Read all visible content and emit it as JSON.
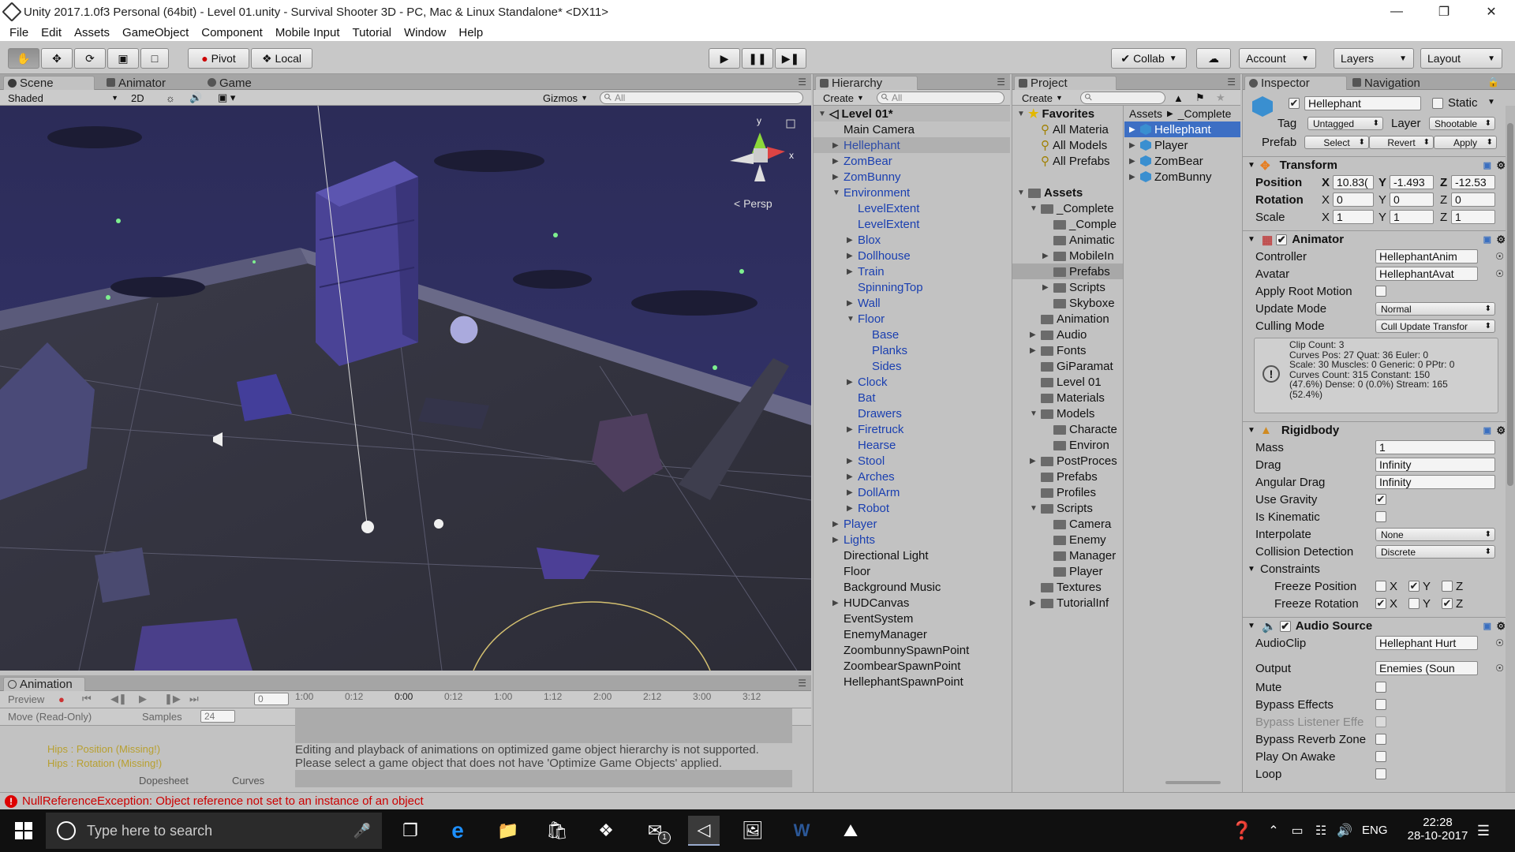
{
  "window": {
    "title": "Unity 2017.1.0f3 Personal (64bit) - Level 01.unity - Survival Shooter 3D - PC, Mac & Linux Standalone* <DX11>",
    "minimize": "—",
    "restore": "❐",
    "close": "✕"
  },
  "menu": [
    "File",
    "Edit",
    "Assets",
    "GameObject",
    "Component",
    "Mobile Input",
    "Tutorial",
    "Window",
    "Help"
  ],
  "toolbar": {
    "pivot": "Pivot",
    "local": "Local",
    "collab": "Collab",
    "account": "Account",
    "layers": "Layers",
    "layout": "Layout"
  },
  "scene": {
    "tabs": [
      "Scene",
      "Animator",
      "Game"
    ],
    "shading": "Shaded",
    "mode2d": "2D",
    "gizmos": "Gizmos",
    "search_placeholder": "All",
    "persp": "Persp",
    "axis_x": "x",
    "axis_y": "y"
  },
  "animation": {
    "tab": "Animation",
    "preview": "Preview",
    "frame": "0",
    "ruler": [
      "1:00",
      "0:12",
      "0:00",
      "0:12",
      "1:00",
      "1:12",
      "2:00",
      "2:12",
      "3:00",
      "3:12"
    ],
    "clip": "Move (Read-Only)",
    "samples_label": "Samples",
    "samples": "24",
    "props": [
      "Hips : Position (Missing!)",
      "Hips : Rotation (Missing!)"
    ],
    "message1": "Editing and playback of animations on optimized game object hierarchy is not supported.",
    "message2": "Please select a game object that does not have 'Optimize Game Objects' applied.",
    "dopesheet": "Dopesheet",
    "curves": "Curves"
  },
  "hierarchy": {
    "tab": "Hierarchy",
    "create": "Create",
    "search_placeholder": "All",
    "scene_name": "Level 01*",
    "items": [
      {
        "label": "Main Camera",
        "indent": 0,
        "arrow": "",
        "blue": false,
        "sel": false
      },
      {
        "label": "Hellephant",
        "indent": 0,
        "arrow": "▶",
        "blue": true,
        "sel": true
      },
      {
        "label": "ZomBear",
        "indent": 0,
        "arrow": "▶",
        "blue": true,
        "sel": false
      },
      {
        "label": "ZomBunny",
        "indent": 0,
        "arrow": "▶",
        "blue": true,
        "sel": false
      },
      {
        "label": "Environment",
        "indent": 0,
        "arrow": "▼",
        "blue": true,
        "sel": false
      },
      {
        "label": "LevelExtent",
        "indent": 1,
        "arrow": "",
        "blue": true,
        "sel": false
      },
      {
        "label": "LevelExtent",
        "indent": 1,
        "arrow": "",
        "blue": true,
        "sel": false
      },
      {
        "label": "Blox",
        "indent": 1,
        "arrow": "▶",
        "blue": true,
        "sel": false
      },
      {
        "label": "Dollhouse",
        "indent": 1,
        "arrow": "▶",
        "blue": true,
        "sel": false
      },
      {
        "label": "Train",
        "indent": 1,
        "arrow": "▶",
        "blue": true,
        "sel": false
      },
      {
        "label": "SpinningTop",
        "indent": 1,
        "arrow": "",
        "blue": true,
        "sel": false
      },
      {
        "label": "Wall",
        "indent": 1,
        "arrow": "▶",
        "blue": true,
        "sel": false
      },
      {
        "label": "Floor",
        "indent": 1,
        "arrow": "▼",
        "blue": true,
        "sel": false
      },
      {
        "label": "Base",
        "indent": 2,
        "arrow": "",
        "blue": true,
        "sel": false
      },
      {
        "label": "Planks",
        "indent": 2,
        "arrow": "",
        "blue": true,
        "sel": false
      },
      {
        "label": "Sides",
        "indent": 2,
        "arrow": "",
        "blue": true,
        "sel": false
      },
      {
        "label": "Clock",
        "indent": 1,
        "arrow": "▶",
        "blue": true,
        "sel": false
      },
      {
        "label": "Bat",
        "indent": 1,
        "arrow": "",
        "blue": true,
        "sel": false
      },
      {
        "label": "Drawers",
        "indent": 1,
        "arrow": "",
        "blue": true,
        "sel": false
      },
      {
        "label": "Firetruck",
        "indent": 1,
        "arrow": "▶",
        "blue": true,
        "sel": false
      },
      {
        "label": "Hearse",
        "indent": 1,
        "arrow": "",
        "blue": true,
        "sel": false
      },
      {
        "label": "Stool",
        "indent": 1,
        "arrow": "▶",
        "blue": true,
        "sel": false
      },
      {
        "label": "Arches",
        "indent": 1,
        "arrow": "▶",
        "blue": true,
        "sel": false
      },
      {
        "label": "DollArm",
        "indent": 1,
        "arrow": "▶",
        "blue": true,
        "sel": false
      },
      {
        "label": "Robot",
        "indent": 1,
        "arrow": "▶",
        "blue": true,
        "sel": false
      },
      {
        "label": "Player",
        "indent": 0,
        "arrow": "▶",
        "blue": true,
        "sel": false
      },
      {
        "label": "Lights",
        "indent": 0,
        "arrow": "▶",
        "blue": true,
        "sel": false
      },
      {
        "label": "Directional Light",
        "indent": 0,
        "arrow": "",
        "blue": false,
        "sel": false
      },
      {
        "label": "Floor",
        "indent": 0,
        "arrow": "",
        "blue": false,
        "sel": false
      },
      {
        "label": "Background Music",
        "indent": 0,
        "arrow": "",
        "blue": false,
        "sel": false
      },
      {
        "label": "HUDCanvas",
        "indent": 0,
        "arrow": "▶",
        "blue": false,
        "sel": false
      },
      {
        "label": "EventSystem",
        "indent": 0,
        "arrow": "",
        "blue": false,
        "sel": false
      },
      {
        "label": "EnemyManager",
        "indent": 0,
        "arrow": "",
        "blue": false,
        "sel": false
      },
      {
        "label": "ZoombunnySpawnPoint",
        "indent": 0,
        "arrow": "",
        "blue": false,
        "sel": false
      },
      {
        "label": "ZoombearSpawnPoint",
        "indent": 0,
        "arrow": "",
        "blue": false,
        "sel": false
      },
      {
        "label": "HellephantSpawnPoint",
        "indent": 0,
        "arrow": "",
        "blue": false,
        "sel": false
      }
    ]
  },
  "project": {
    "tab": "Project",
    "create": "Create",
    "favorites": "Favorites",
    "fav_items": [
      "All Materia",
      "All Models",
      "All Prefabs"
    ],
    "assets_root": "Assets",
    "folders": [
      {
        "label": "_Complete",
        "indent": 1,
        "arrow": "▼",
        "sel": false
      },
      {
        "label": "_Comple",
        "indent": 2,
        "arrow": "",
        "sel": false
      },
      {
        "label": "Animatic",
        "indent": 2,
        "arrow": "",
        "sel": false
      },
      {
        "label": "MobileIn",
        "indent": 2,
        "arrow": "▶",
        "sel": false
      },
      {
        "label": "Prefabs",
        "indent": 2,
        "arrow": "",
        "sel": true
      },
      {
        "label": "Scripts",
        "indent": 2,
        "arrow": "▶",
        "sel": false
      },
      {
        "label": "Skyboxe",
        "indent": 2,
        "arrow": "",
        "sel": false
      },
      {
        "label": "Animation",
        "indent": 1,
        "arrow": "",
        "sel": false
      },
      {
        "label": "Audio",
        "indent": 1,
        "arrow": "▶",
        "sel": false
      },
      {
        "label": "Fonts",
        "indent": 1,
        "arrow": "▶",
        "sel": false
      },
      {
        "label": "GiParamat",
        "indent": 1,
        "arrow": "",
        "sel": false
      },
      {
        "label": "Level 01",
        "indent": 1,
        "arrow": "",
        "sel": false
      },
      {
        "label": "Materials",
        "indent": 1,
        "arrow": "",
        "sel": false
      },
      {
        "label": "Models",
        "indent": 1,
        "arrow": "▼",
        "sel": false
      },
      {
        "label": "Characte",
        "indent": 2,
        "arrow": "",
        "sel": false
      },
      {
        "label": "Environ",
        "indent": 2,
        "arrow": "",
        "sel": false
      },
      {
        "label": "PostProces",
        "indent": 1,
        "arrow": "▶",
        "sel": false
      },
      {
        "label": "Prefabs",
        "indent": 1,
        "arrow": "",
        "sel": false
      },
      {
        "label": "Profiles",
        "indent": 1,
        "arrow": "",
        "sel": false
      },
      {
        "label": "Scripts",
        "indent": 1,
        "arrow": "▼",
        "sel": false
      },
      {
        "label": "Camera",
        "indent": 2,
        "arrow": "",
        "sel": false
      },
      {
        "label": "Enemy",
        "indent": 2,
        "arrow": "",
        "sel": false
      },
      {
        "label": "Manager",
        "indent": 2,
        "arrow": "",
        "sel": false
      },
      {
        "label": "Player",
        "indent": 2,
        "arrow": "",
        "sel": false
      },
      {
        "label": "Textures",
        "indent": 1,
        "arrow": "",
        "sel": false
      },
      {
        "label": "TutorialInf",
        "indent": 1,
        "arrow": "▶",
        "sel": false
      }
    ],
    "breadcrumb": [
      "Assets",
      "_Complete"
    ],
    "assets": [
      {
        "label": "Hellephant",
        "sel": true
      },
      {
        "label": "Player",
        "sel": false
      },
      {
        "label": "ZomBear",
        "sel": false
      },
      {
        "label": "ZomBunny",
        "sel": false
      }
    ]
  },
  "inspector": {
    "tab": "Inspector",
    "tab2": "Navigation",
    "name": "Hellephant",
    "static": "Static",
    "tag_label": "Tag",
    "tag": "Untagged",
    "layer_label": "Layer",
    "layer": "Shootable",
    "prefab_label": "Prefab",
    "select": "Select",
    "revert": "Revert",
    "apply": "Apply",
    "transform": {
      "title": "Transform",
      "position_label": "Position",
      "pos": [
        "10.83(",
        "-1.493",
        "-12.53"
      ],
      "rotation_label": "Rotation",
      "rot": [
        "0",
        "0",
        "0"
      ],
      "scale_label": "Scale",
      "scale": [
        "1",
        "1",
        "1"
      ],
      "x": "X",
      "y": "Y",
      "z": "Z"
    },
    "animator": {
      "title": "Animator",
      "controller_label": "Controller",
      "controller": "HellephantAnim",
      "avatar_label": "Avatar",
      "avatar": "HellephantAvat",
      "apply_root_label": "Apply Root Motion",
      "update_mode_label": "Update Mode",
      "update_mode": "Normal",
      "culling_label": "Culling Mode",
      "culling": "Cull Update Transfor",
      "info": [
        "Clip Count: 3",
        "Curves Pos: 27 Quat: 36 Euler: 0",
        "Scale: 30 Muscles: 0 Generic: 0 PPtr: 0",
        "Curves Count: 315 Constant: 150",
        "(47.6%) Dense: 0 (0.0%) Stream: 165",
        "(52.4%)"
      ]
    },
    "rigidbody": {
      "title": "Rigidbody",
      "mass_label": "Mass",
      "mass": "1",
      "drag_label": "Drag",
      "drag": "Infinity",
      "angular_label": "Angular Drag",
      "angular": "Infinity",
      "gravity_label": "Use Gravity",
      "kinematic_label": "Is Kinematic",
      "interpolate_label": "Interpolate",
      "interpolate": "None",
      "collision_label": "Collision Detection",
      "collision": "Discrete",
      "constraints_label": "Constraints",
      "freeze_pos_label": "Freeze Position",
      "freeze_rot_label": "Freeze Rotation",
      "check": "✔"
    },
    "audio": {
      "title": "Audio Source",
      "clip_label": "AudioClip",
      "clip": "Hellephant Hurt",
      "output_label": "Output",
      "output": "Enemies (Soun",
      "mute_label": "Mute",
      "bypass_effects_label": "Bypass Effects",
      "bypass_listener_label": "Bypass Listener Effe",
      "bypass_reverb_label": "Bypass Reverb Zone",
      "play_awake_label": "Play On Awake",
      "loop_label": "Loop"
    }
  },
  "status": {
    "error": "NullReferenceException: Object reference not set to an instance of an object"
  },
  "taskbar": {
    "search": "Type here to search",
    "lang": "ENG",
    "time": "22:28",
    "date": "28-10-2017",
    "badge": "1"
  }
}
